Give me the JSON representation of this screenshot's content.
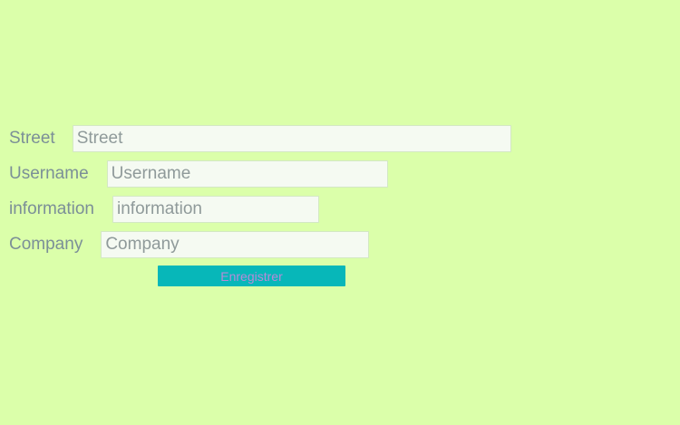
{
  "form": {
    "fields": [
      {
        "label": "Street",
        "placeholder": "Street",
        "value": ""
      },
      {
        "label": "Username",
        "placeholder": "Username",
        "value": ""
      },
      {
        "label": "information",
        "placeholder": "information",
        "value": ""
      },
      {
        "label": "Company",
        "placeholder": "Company",
        "value": ""
      }
    ],
    "submit_label": "Enregistrer"
  },
  "colors": {
    "background": "#dbffaa",
    "label_text": "#7b8f97",
    "input_background": "#f5faf2",
    "button_background": "#07b7b9",
    "button_text": "#b88ad7"
  }
}
